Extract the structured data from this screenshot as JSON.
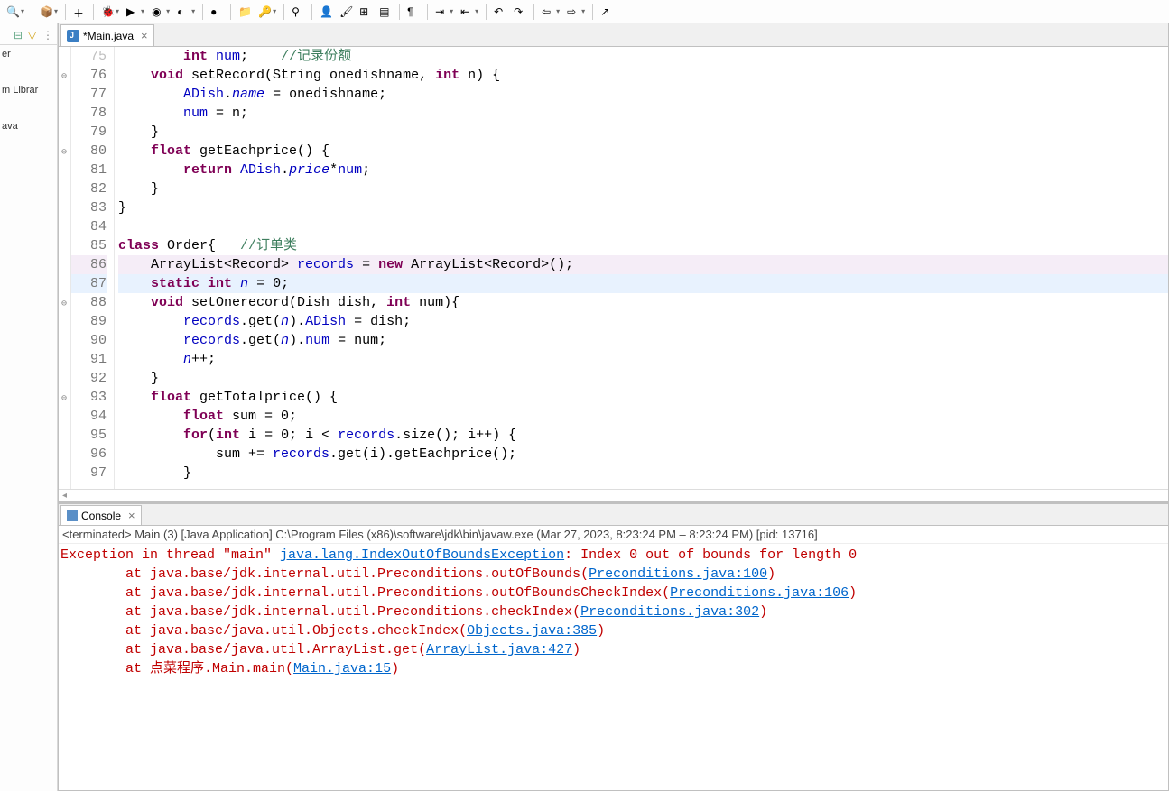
{
  "toolbar": {
    "items": [
      {
        "name": "search-icon",
        "glyph": "🔍",
        "dd": true
      },
      {
        "name": "package-icon",
        "glyph": "📦",
        "dd": true
      },
      {
        "name": "new-icon",
        "glyph": "＋",
        "dd": false
      },
      {
        "name": "debug-icon",
        "glyph": "🐞",
        "dd": true
      },
      {
        "name": "run-icon",
        "glyph": "▶",
        "dd": true
      },
      {
        "name": "coverage-icon",
        "glyph": "◉",
        "dd": true
      },
      {
        "name": "run-ext-icon",
        "glyph": "◐",
        "dd": true
      },
      {
        "name": "breakpoint-icon",
        "glyph": "●",
        "dd": false
      },
      {
        "name": "new-project-icon",
        "glyph": "📁",
        "dd": false
      },
      {
        "name": "key-icon",
        "glyph": "🔑",
        "dd": true
      },
      {
        "name": "wand-icon",
        "glyph": "⚲",
        "dd": false
      },
      {
        "name": "person-icon",
        "glyph": "👤",
        "dd": false
      },
      {
        "name": "paint-icon",
        "glyph": "🖌",
        "dd": false
      },
      {
        "name": "form-icon",
        "glyph": "⊞",
        "dd": false
      },
      {
        "name": "page-icon",
        "glyph": "▤",
        "dd": false
      },
      {
        "name": "pilcrow-icon",
        "glyph": "¶",
        "dd": false
      },
      {
        "name": "step-icon",
        "glyph": "⇥",
        "dd": true
      },
      {
        "name": "step2-icon",
        "glyph": "⇤",
        "dd": true
      },
      {
        "name": "undo-nav-icon",
        "glyph": "↶",
        "dd": false
      },
      {
        "name": "redo-nav-icon",
        "glyph": "↷",
        "dd": false
      },
      {
        "name": "back-icon",
        "glyph": "⇦",
        "dd": true
      },
      {
        "name": "forward-icon",
        "glyph": "⇨",
        "dd": true
      },
      {
        "name": "external-icon",
        "glyph": "↗",
        "dd": false
      }
    ]
  },
  "leftPanel": {
    "nodes": [
      "er",
      "m Librar",
      "ava"
    ]
  },
  "editor": {
    "tabTitle": "*Main.java",
    "lines": [
      {
        "n": 75,
        "dim": true,
        "annot": "",
        "html": "        <span class='kw'>int</span> <span class='fld'>num</span>;    <span class='cm'>//记录份额</span>"
      },
      {
        "n": 76,
        "annot": "⊖",
        "html": "    <span class='kw'>void</span> setRecord(String onedishname, <span class='kw'>int</span> n) {"
      },
      {
        "n": 77,
        "html": "        <span class='fld'>ADish</span>.<span class='fld it'>name</span> = onedishname;"
      },
      {
        "n": 78,
        "html": "        <span class='fld'>num</span> = n;"
      },
      {
        "n": 79,
        "html": "    }"
      },
      {
        "n": 80,
        "annot": "⊖",
        "html": "    <span class='kw'>float</span> getEachprice() {"
      },
      {
        "n": 81,
        "html": "        <span class='kw'>return</span> <span class='fld'>ADish</span>.<span class='fld it'>price</span>*<span class='fld'>num</span>;"
      },
      {
        "n": 82,
        "html": "    }"
      },
      {
        "n": 83,
        "html": "}"
      },
      {
        "n": 84,
        "html": ""
      },
      {
        "n": 85,
        "html": "<span class='kw'>class</span> Order{   <span class='cm'>//订单类</span>"
      },
      {
        "n": 86,
        "hl": "hl-86",
        "html": "    ArrayList&lt;Record&gt; <span class='fld'>records</span> = <span class='kw'>new</span> ArrayList&lt;Record&gt;();"
      },
      {
        "n": 87,
        "hl": "hl-87",
        "html": "    <span class='kw'>static</span> <span class='kw'>int</span> <span class='fld it'>n</span> = 0;"
      },
      {
        "n": 88,
        "annot": "⊖",
        "html": "    <span class='kw'>void</span> setOnerecord(Dish dish, <span class='kw'>int</span> num){"
      },
      {
        "n": 89,
        "html": "        <span class='fld'>records</span>.get(<span class='fld it'>n</span>).<span class='fld'>ADish</span> = dish;"
      },
      {
        "n": 90,
        "html": "        <span class='fld'>records</span>.get(<span class='fld it'>n</span>).<span class='fld'>num</span> = num;"
      },
      {
        "n": 91,
        "html": "        <span class='fld it'>n</span>++;"
      },
      {
        "n": 92,
        "html": "    }"
      },
      {
        "n": 93,
        "annot": "⊖",
        "html": "    <span class='kw'>float</span> getTotalprice() {"
      },
      {
        "n": 94,
        "html": "        <span class='kw'>float</span> sum = 0;"
      },
      {
        "n": 95,
        "html": "        <span class='kw'>for</span>(<span class='kw'>int</span> i = 0; i &lt; <span class='fld'>records</span>.size(); i++) {"
      },
      {
        "n": 96,
        "html": "            sum += <span class='fld'>records</span>.get(i).getEachprice();"
      },
      {
        "n": 97,
        "html": "        }"
      }
    ]
  },
  "console": {
    "tabTitle": "Console",
    "status": "<terminated> Main (3) [Java Application] C:\\Program Files (x86)\\software\\jdk\\bin\\javaw.exe (Mar 27, 2023, 8:23:24 PM – 8:23:24 PM) [pid: 13716]",
    "lines": [
      {
        "html": "<span class='err'>Exception in thread \"main\" </span><span class='link'>java.lang.IndexOutOfBoundsException</span><span class='err'>: Index 0 out of bounds for length 0</span>"
      },
      {
        "html": "<span class='err'>        at java.base/jdk.internal.util.Preconditions.outOfBounds(</span><span class='link'>Preconditions.java:100</span><span class='err'>)</span>"
      },
      {
        "html": "<span class='err'>        at java.base/jdk.internal.util.Preconditions.outOfBoundsCheckIndex(</span><span class='link'>Preconditions.java:106</span><span class='err'>)</span>"
      },
      {
        "html": "<span class='err'>        at java.base/jdk.internal.util.Preconditions.checkIndex(</span><span class='link'>Preconditions.java:302</span><span class='err'>)</span>"
      },
      {
        "html": "<span class='err'>        at java.base/java.util.Objects.checkIndex(</span><span class='link'>Objects.java:385</span><span class='err'>)</span>"
      },
      {
        "html": "<span class='err'>        at java.base/java.util.ArrayList.get(</span><span class='link'>ArrayList.java:427</span><span class='err'>)</span>"
      },
      {
        "html": "<span class='err'>        at 点菜程序.Main.main(</span><span class='link'>Main.java:15</span><span class='err'>)</span>"
      }
    ]
  }
}
